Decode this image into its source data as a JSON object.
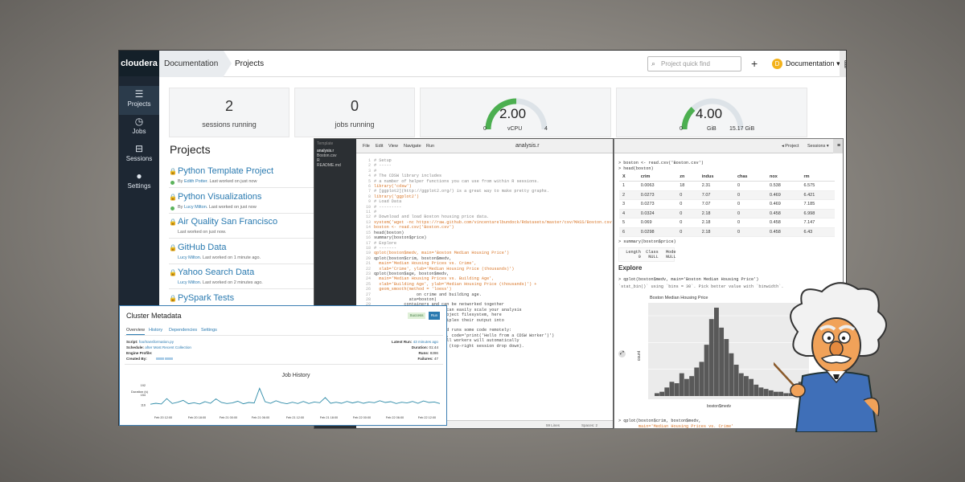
{
  "app": {
    "logo": "cloudera",
    "breadcrumb": [
      "Documentation",
      "Projects"
    ],
    "search_placeholder": "Project quick find",
    "add_label": "+",
    "user_initial": "D",
    "user_label": "Documentation"
  },
  "sidebar": [
    {
      "label": "Projects",
      "icon": "projects-icon",
      "glyph": "☰"
    },
    {
      "label": "Jobs",
      "icon": "clock-icon",
      "glyph": "◷"
    },
    {
      "label": "Sessions",
      "icon": "book-icon",
      "glyph": "⊟"
    },
    {
      "label": "Settings",
      "icon": "user-icon",
      "glyph": "●"
    }
  ],
  "stats": {
    "sessions": {
      "value": "2",
      "label": "sessions running"
    },
    "jobs": {
      "value": "0",
      "label": "jobs running"
    },
    "vcpu": {
      "value": "2.00",
      "unit": "vCPU",
      "min": "0",
      "max": "4",
      "fraction": 0.5
    },
    "memory": {
      "value": "4.00",
      "unit": "GiB",
      "min": "0",
      "max": "15.17 GiB",
      "fraction": 0.26
    }
  },
  "projects": {
    "title": "Projects",
    "items": [
      {
        "name": "Python Template Project",
        "by": "By",
        "user": "Edith Potter",
        "when": ". Last worked on just now",
        "active": true
      },
      {
        "name": "Python Visualizations",
        "by": "By",
        "user": "Lucy Milton",
        "when": ". Last worked on just now",
        "active": true
      },
      {
        "name": "Air Quality San Francisco",
        "by": "",
        "user": "",
        "when": "Last worked on just now.",
        "active": false
      },
      {
        "name": "GitHub Data",
        "by": "",
        "user": "Lucy Milton",
        "when": ". Last worked on 1 minute ago.",
        "active": false
      },
      {
        "name": "Yahoo Search Data",
        "by": "",
        "user": "Lucy Milton",
        "when": ". Last worked on 2 minutes ago.",
        "active": false
      },
      {
        "name": "PySpark Tests",
        "by": "",
        "user": "",
        "when": "",
        "active": false
      }
    ]
  },
  "editor": {
    "menu": [
      "File",
      "Edit",
      "View",
      "Navigate",
      "Run"
    ],
    "filename": "analysis.r",
    "files": [
      "Template",
      "analysis.r",
      "Boston.csv",
      "R",
      "README.md"
    ],
    "project_label": "Project",
    "sessions_label": "Sessions",
    "code": [
      "# Setup",
      "# -----",
      "#",
      "# The CDSW library includes",
      "# a number of helper functions you can use from within R sessions.",
      "",
      "library('cdsw')",
      "",
      "# [ggplot2](http://ggplot2.org/) is a great way to make pretty graphs.",
      "",
      "library('ggplot2')",
      "",
      "# Load Data",
      "# ---------",
      "#",
      "# Download and load Boston housing price data.",
      "",
      "system('wget -nc https://raw.github.com/vincentarelbundock/Rdatasets/master/csv/MASS/Boston.csv')",
      "boston <- read.csv('Boston.csv')",
      "head(boston)",
      "summary(boston$price)",
      "",
      "# Explore",
      "# -------",
      "",
      "qplot(boston$medv, main='Boston Median Housing Price')",
      "qplot(boston$crim, boston$medv,",
      "  main='Median Housing Prices vs. Crime',",
      "  xlab='Crime', ylab='Median Housing Price (thousands)')",
      "qplot(boston$age, boston$medv,",
      "  main='Median Housing Prices vs. Building Age',",
      "  xlab='Building Age', ylab='Median Housing Price (thousands)') +",
      "  geom_smooth(method = 'loess')",
      "",
      "",
      "",
      "",
      "",
      "                 on crime and building age.",
      "",
      "              ata=boston)",
      "",
      "",
      "",
      "            containers and can be networked together",
      "            ing workers, you can easily scale your analysis",
      "            share the same project filesystem, here",
      "            network, and multiplex their output into",
      "            sy debugging.",
      "",
      "            ts two workers and runs some code remotely:",
      "",
      "            u=0.2, memory=0.5, code='print('Hello from a CDSW Worker')')",
      "",
      "            top.workers()`. All workers will automatically",
      "            e session as well (top-right session drop down)."
    ],
    "status": [
      "59 Lines",
      "Spaces: 2"
    ]
  },
  "console": {
    "cmd1": "> boston <- read.csv('Boston.csv')",
    "cmd2": "> head(boston)",
    "columns": [
      "X",
      "crim",
      "zn",
      "indus",
      "chas",
      "nox",
      "rm"
    ],
    "rows": [
      [
        "1",
        "0.0063",
        "18",
        "2.31",
        "0",
        "0.538",
        "6.575"
      ],
      [
        "2",
        "0.0273",
        "0",
        "7.07",
        "0",
        "0.469",
        "6.421"
      ],
      [
        "3",
        "0.0273",
        "0",
        "7.07",
        "0",
        "0.469",
        "7.185"
      ],
      [
        "4",
        "0.0324",
        "0",
        "2.18",
        "0",
        "0.458",
        "6.998"
      ],
      [
        "5",
        "0.069",
        "0",
        "2.18",
        "0",
        "0.458",
        "7.147"
      ],
      [
        "6",
        "0.0298",
        "0",
        "2.18",
        "0",
        "0.458",
        "6.43"
      ]
    ],
    "cmd3": "> summary(boston$price)",
    "summary": "  Length  Class   Mode\n       0   NULL   NULL",
    "explore_heading": "Explore",
    "cmd4": "> qplot(boston$medv, main='Boston Median Housing Price')",
    "warning": "`stat_bin()` using `bins = 30`. Pick better value with `binwidth`.",
    "cmd5": "> qplot(boston$crim, boston$medv,",
    "cmd6": "        main='Median Housing Prices vs. Crime'"
  },
  "histogram": {
    "title": "Boston Median Housing Price",
    "xlabel": "boston$medv",
    "ylabel": "count"
  },
  "chart_data": [
    {
      "type": "bar",
      "title": "Boston Median Housing Price",
      "xlabel": "boston$medv",
      "ylabel": "count",
      "values": [
        2,
        3,
        6,
        10,
        9,
        16,
        12,
        14,
        20,
        24,
        36,
        54,
        62,
        48,
        40,
        30,
        22,
        16,
        14,
        12,
        8,
        6,
        5,
        4,
        3,
        3,
        2,
        2,
        2,
        10
      ]
    },
    {
      "type": "line",
      "title": "Job History",
      "ylabel": "Duration (s)",
      "y_ticks": [
        "192",
        "154",
        "116"
      ],
      "x_ticks": [
        "Feb 20 12:00",
        "Feb 20 18:00",
        "Feb 21 00:00",
        "Feb 21 06:00",
        "Feb 21 12:00",
        "Feb 21 18:00",
        "Feb 22 00:00",
        "Feb 22 06:00",
        "Feb 22 12:00",
        "Feb 23 00:00"
      ],
      "ylim": [
        100,
        200
      ],
      "values": [
        118,
        122,
        119,
        140,
        121,
        126,
        133,
        120,
        124,
        119,
        128,
        122,
        139,
        125,
        121,
        123,
        130,
        120,
        125,
        123,
        180,
        128,
        122,
        132,
        124,
        120,
        126,
        121,
        129,
        121,
        127,
        124,
        144,
        122,
        126,
        122,
        129,
        123,
        128,
        122,
        127,
        124,
        132,
        125,
        128,
        121,
        126,
        123,
        129,
        122,
        131,
        125,
        127,
        121
      ]
    }
  ],
  "metadata": {
    "title": "Cluster Metadata",
    "success_label": "Success",
    "run_label": "Run",
    "tabs": [
      "Overview",
      "History",
      "Dependencies",
      "Settings"
    ],
    "script_key": "Script:",
    "script_val": "foo/transformation.py",
    "schedule_key": "Schedule:",
    "schedule_val": "after Most Recent Collection",
    "profile_key": "Engine Profile:",
    "created_key": "Created By:",
    "latest_key": "Latest Run:",
    "latest_val": "43 minutes ago",
    "duration_key": "Duration:",
    "duration_val": "01:44",
    "runs_key": "Runs:",
    "runs_val": "8286",
    "failures_key": "Failures:",
    "failures_val": "47"
  }
}
